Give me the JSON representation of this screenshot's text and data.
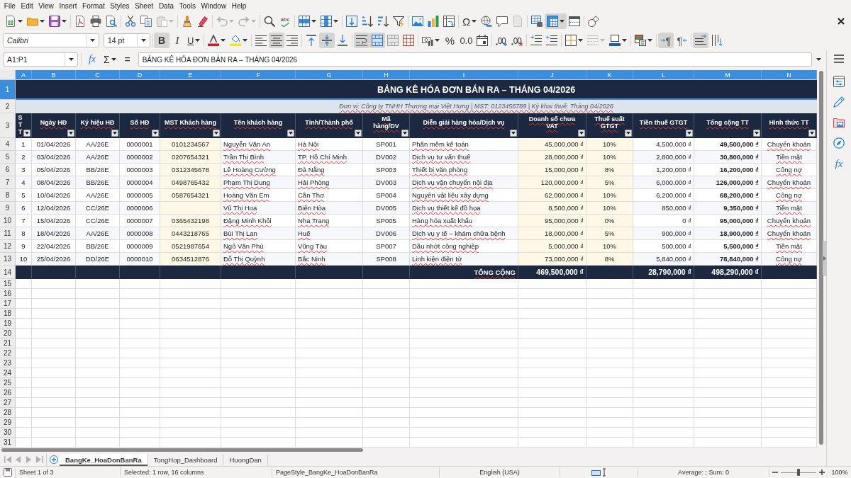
{
  "menu_bar": {
    "items": [
      "File",
      "Edit",
      "View",
      "Insert",
      "Format",
      "Styles",
      "Sheet",
      "Data",
      "Tools",
      "Window",
      "Help"
    ]
  },
  "standard_toolbar": {
    "paste_disabled": true,
    "undo_disabled": true,
    "redo_disabled": true,
    "spelling_label": "abc",
    "special_character_label": "Ω",
    "header_footer_disabled": true,
    "freeze_on": true
  },
  "formatting_toolbar": {
    "font_name": "Calibri",
    "font_size": "14 pt",
    "style_buttons": [
      {
        "kind": "bold",
        "label": "B",
        "on": true
      },
      {
        "kind": "italic",
        "label": "I",
        "on": false
      },
      {
        "kind": "underline",
        "label": "U",
        "on": false
      }
    ],
    "horizontal_align_buttons": [
      {
        "kind": "left",
        "on": false
      },
      {
        "kind": "center",
        "on": true
      },
      {
        "kind": "right",
        "on": false
      }
    ],
    "vertical_align_buttons": [
      {
        "kind": "top",
        "on": false
      },
      {
        "kind": "middle",
        "on": true
      },
      {
        "kind": "bottom",
        "on": false
      }
    ],
    "wrap_text_on": true,
    "merge_and_center_on": true,
    "percent_label": "%",
    "number_label": "0.0",
    "border_style_disabled": true,
    "direction_buttons": [
      {
        "kind": "left_to_right",
        "label": "¶",
        "on": true
      },
      {
        "kind": "right_to_left",
        "label": "¶",
        "on": false
      }
    ],
    "text_orientation_buttons": [
      {
        "kind": "horizontal",
        "on": true
      },
      {
        "kind": "vertical",
        "on": false
      }
    ]
  },
  "formula_bar": {
    "name_box": "A1:P1",
    "function_wizard_label": "fx",
    "sum_label": "Σ",
    "equals_label": "=",
    "content": "BẢNG KÊ HÓA ĐƠN BÁN RA – THÁNG 04/2026"
  },
  "sidebar": {
    "functions_label": "fx"
  },
  "sheet": {
    "column_headers": [
      {
        "label": "A",
        "selected": true
      },
      {
        "label": "B",
        "selected": true
      },
      {
        "label": "C",
        "selected": true
      },
      {
        "label": "D",
        "selected": true
      },
      {
        "label": "E",
        "selected": true
      },
      {
        "label": "F",
        "selected": true
      },
      {
        "label": "G",
        "selected": true
      },
      {
        "label": "H",
        "selected": true
      },
      {
        "label": "I",
        "selected": true
      },
      {
        "label": "J",
        "selected": true
      },
      {
        "label": "K",
        "selected": true
      },
      {
        "label": "L",
        "selected": true
      },
      {
        "label": "M",
        "selected": true
      },
      {
        "label": "N",
        "selected": true
      }
    ],
    "row_headers": [
      {
        "label": "1",
        "selected": true
      },
      {
        "label": "2",
        "selected": false
      },
      {
        "label": "3",
        "selected": false
      },
      {
        "label": "4",
        "selected": false
      },
      {
        "label": "5",
        "selected": false
      },
      {
        "label": "6",
        "selected": false
      },
      {
        "label": "7",
        "selected": false
      },
      {
        "label": "8",
        "selected": false
      },
      {
        "label": "9",
        "selected": false
      },
      {
        "label": "10",
        "selected": false
      },
      {
        "label": "11",
        "selected": false
      },
      {
        "label": "12",
        "selected": false
      },
      {
        "label": "13",
        "selected": false
      },
      {
        "label": "14",
        "selected": false
      },
      {
        "label": "15",
        "selected": false
      },
      {
        "label": "16",
        "selected": false
      },
      {
        "label": "17",
        "selected": false
      },
      {
        "label": "18",
        "selected": false
      },
      {
        "label": "19",
        "selected": false
      },
      {
        "label": "20",
        "selected": false
      },
      {
        "label": "21",
        "selected": false
      },
      {
        "label": "22",
        "selected": false
      },
      {
        "label": "23",
        "selected": false
      },
      {
        "label": "24",
        "selected": false
      },
      {
        "label": "25",
        "selected": false
      },
      {
        "label": "26",
        "selected": false
      },
      {
        "label": "27",
        "selected": false
      },
      {
        "label": "28",
        "selected": false
      },
      {
        "label": "29",
        "selected": false
      },
      {
        "label": "30",
        "selected": false
      },
      {
        "label": "31",
        "selected": false
      }
    ],
    "title": "BẢNG KÊ HÓA ĐƠN BÁN RA – THÁNG 04/2026",
    "subtitle": "Đơn vị: Công ty TNHH Thương mại Việt Hưng | MST: 0123456789 | Kỳ khai thuế: Tháng 04/2026",
    "table": {
      "columns": [
        "STT",
        "Ngày HĐ",
        "Ký hiệu HĐ",
        "Số HĐ",
        "MST Khách hàng",
        "Tên khách hàng",
        "Tỉnh/Thành phố",
        "Mã hàng/DV",
        "Diễn giải hàng hóa/Dịch vụ",
        "Doanh số chưa VAT",
        "Thuế suất GTGT",
        "Tiền thuế GTGT",
        "Tổng cộng TT",
        "Hình thức TT"
      ],
      "rows": [
        {
          "no": "1",
          "invoice_date": "01/04/2026",
          "invoice_symbol": "AA/26E",
          "invoice_number": "0000001",
          "customer_tax_code": "0101234567",
          "customer_name": "Nguyễn Văn An",
          "province": "Hà Nội",
          "item_code": "SP001",
          "description": "Phần mềm kế toán",
          "revenue_before_vat": "45,000,000 ₫",
          "vat_rate": "10%",
          "vat_amount": "4,500,000 ₫",
          "total_payment": "49,500,000 ₫",
          "payment_method": "Chuyển khoản"
        },
        {
          "no": "2",
          "invoice_date": "03/04/2026",
          "invoice_symbol": "AA/26E",
          "invoice_number": "0000002",
          "customer_tax_code": "0207654321",
          "customer_name": "Trần Thị Bình",
          "province": "TP. Hồ Chí Minh",
          "item_code": "DV002",
          "description": "Dịch vụ tư vấn thuế",
          "revenue_before_vat": "28,000,000 ₫",
          "vat_rate": "10%",
          "vat_amount": "2,800,000 ₫",
          "total_payment": "30,800,000 ₫",
          "payment_method": "Tiền mặt"
        },
        {
          "no": "3",
          "invoice_date": "05/04/2026",
          "invoice_symbol": "BB/26E",
          "invoice_number": "0000003",
          "customer_tax_code": "0312345678",
          "customer_name": "Lê Hoàng Cường",
          "province": "Đà Nẵng",
          "item_code": "SP003",
          "description": "Thiết bị văn phòng",
          "revenue_before_vat": "15,000,000 ₫",
          "vat_rate": "8%",
          "vat_amount": "1,200,000 ₫",
          "total_payment": "16,200,000 ₫",
          "payment_method": "Công nợ"
        },
        {
          "no": "4",
          "invoice_date": "08/04/2026",
          "invoice_symbol": "BB/26E",
          "invoice_number": "0000004",
          "customer_tax_code": "0498765432",
          "customer_name": "Phạm Thị Dung",
          "province": "Hải Phòng",
          "item_code": "DV003",
          "description": "Dịch vụ vận chuyển nội địa",
          "revenue_before_vat": "120,000,000 ₫",
          "vat_rate": "5%",
          "vat_amount": "6,000,000 ₫",
          "total_payment": "126,000,000 ₫",
          "payment_method": "Chuyển khoản"
        },
        {
          "no": "5",
          "invoice_date": "10/04/2026",
          "invoice_symbol": "AA/26E",
          "invoice_number": "0000005",
          "customer_tax_code": "0587654321",
          "customer_name": "Hoàng Văn Em",
          "province": "Cần Thơ",
          "item_code": "SP004",
          "description": "Nguyên vật liệu xây dựng",
          "revenue_before_vat": "62,000,000 ₫",
          "vat_rate": "10%",
          "vat_amount": "6,200,000 ₫",
          "total_payment": "68,200,000 ₫",
          "payment_method": "Công nợ"
        },
        {
          "no": "6",
          "invoice_date": "12/04/2026",
          "invoice_symbol": "CC/26E",
          "invoice_number": "0000006",
          "customer_name": "Vũ Thị Hoa",
          "province": "Biên Hòa",
          "item_code": "DV005",
          "description": "Dịch vụ thiết kế đồ họa",
          "revenue_before_vat": "8,500,000 ₫",
          "vat_rate": "10%",
          "vat_amount": "850,000 ₫",
          "total_payment": "9,350,000 ₫",
          "payment_method": "Tiền mặt"
        },
        {
          "no": "7",
          "invoice_date": "15/04/2026",
          "invoice_symbol": "CC/26E",
          "invoice_number": "0000007",
          "customer_tax_code": "0365432198",
          "customer_name": "Đặng Minh Khôi",
          "province": "Nha Trang",
          "item_code": "SP005",
          "description": "Hàng hóa xuất khẩu",
          "revenue_before_vat": "95,000,000 ₫",
          "vat_rate": "0%",
          "vat_amount": "0 ₫",
          "total_payment": "95,000,000 ₫",
          "payment_method": "Chuyển khoản"
        },
        {
          "no": "8",
          "invoice_date": "18/04/2026",
          "invoice_symbol": "AA/26E",
          "invoice_number": "0000008",
          "customer_tax_code": "0443218765",
          "customer_name": "Bùi Thị Lan",
          "province": "Huế",
          "item_code": "DV006",
          "description": "Dịch vụ y tế – khám chữa bệnh",
          "revenue_before_vat": "18,000,000 ₫",
          "vat_rate": "5%",
          "vat_amount": "900,000 ₫",
          "total_payment": "18,900,000 ₫",
          "payment_method": "Chuyển khoản"
        },
        {
          "no": "9",
          "invoice_date": "22/04/2026",
          "invoice_symbol": "BB/26E",
          "invoice_number": "0000009",
          "customer_tax_code": "0521987654",
          "customer_name": "Ngô Văn Phú",
          "province": "Vũng Tàu",
          "item_code": "SP007",
          "description": "Dầu nhớt công nghiệp",
          "revenue_before_vat": "5,000,000 ₫",
          "vat_rate": "10%",
          "vat_amount": "500,000 ₫",
          "total_payment": "5,500,000 ₫",
          "payment_method": "Tiền mặt"
        },
        {
          "no": "10",
          "invoice_date": "25/04/2026",
          "invoice_symbol": "DD/26E",
          "invoice_number": "0000010",
          "customer_tax_code": "0634512876",
          "customer_name": "Đỗ Thị Quỳnh",
          "province": "Bắc Ninh",
          "item_code": "SP008",
          "description": "Linh kiện điện tử",
          "revenue_before_vat": "73,000,000 ₫",
          "vat_rate": "8%",
          "vat_amount": "5,840,000 ₫",
          "total_payment": "78,840,000 ₫",
          "payment_method": "Công nợ"
        }
      ],
      "totals": {
        "label": "TỔNG CỘNG",
        "revenue_before_vat": "469,500,000 ₫",
        "vat_amount": "28,790,000 ₫",
        "total_payment": "498,290,000 ₫"
      }
    }
  },
  "sheet_tabs": [
    {
      "label": "BangKe_HoaDonBanRa",
      "selected": true
    },
    {
      "label": "TongHop_Dashboard",
      "selected": false
    },
    {
      "label": "HuongDan",
      "selected": false
    }
  ],
  "status_bar": {
    "sheet_position": "Sheet 1 of 3",
    "selection_summary": "Selected: 1 row, 16 columns",
    "page_style": "PageStyle_BangKe_HoaDonBanRa",
    "language": "English (USA)",
    "statistics": "Average: ; Sum: 0",
    "zoom": {
      "level": 0.5,
      "reading": "100%"
    }
  }
}
